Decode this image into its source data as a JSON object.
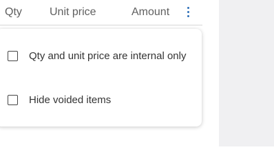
{
  "table_header": {
    "qty": "Qty",
    "unit_price": "Unit price",
    "amount": "Amount",
    "more_icon": "more-vertical-icon"
  },
  "menu": {
    "options": [
      {
        "label": "Qty and unit price are internal only",
        "checked": false
      },
      {
        "label": "Hide voided items",
        "checked": false
      }
    ]
  },
  "colors": {
    "accent": "#2d6fb8",
    "side_panel": "#f0f0f2",
    "header_text": "#5f5f5f"
  }
}
